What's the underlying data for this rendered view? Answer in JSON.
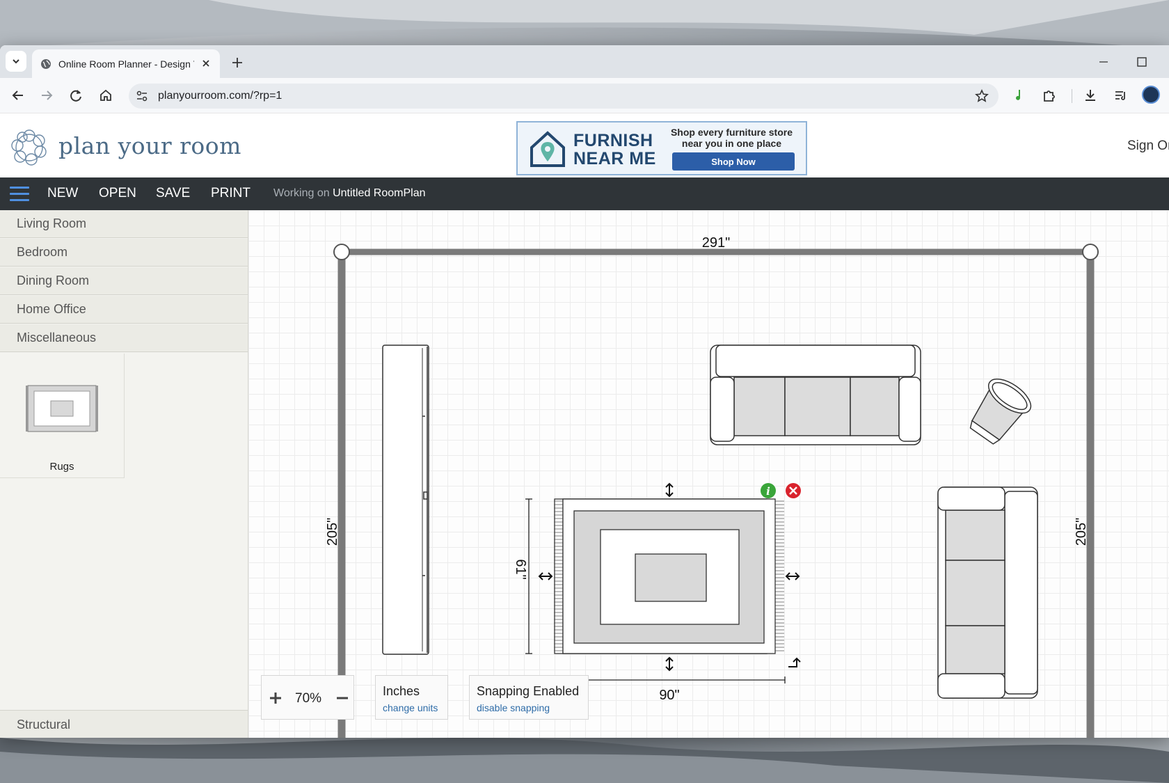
{
  "browser": {
    "tab_title": "Online Room Planner - Design Y",
    "url": "planyourroom.com/?rp=1"
  },
  "site": {
    "logo_text": "plan your room",
    "sign_on": "Sign On",
    "ad": {
      "brand_line1": "FURNISH",
      "brand_line2": "NEAR ME",
      "tagline": "Shop every furniture store near you in one place",
      "cta": "Shop Now"
    }
  },
  "menubar": {
    "new": "NEW",
    "open": "OPEN",
    "save": "SAVE",
    "print": "PRINT",
    "working_prefix": "Working on",
    "plan_name": "Untitled RoomPlan"
  },
  "sidebar": {
    "categories": [
      "Living Room",
      "Bedroom",
      "Dining Room",
      "Home Office",
      "Miscellaneous"
    ],
    "tile_label": "Rugs",
    "structural": "Structural"
  },
  "plan": {
    "room_width": "291\"",
    "room_height_left": "205\"",
    "room_height_right": "205\"",
    "rug_height": "61\"",
    "rug_width": "90\""
  },
  "controls": {
    "zoom": "70%",
    "units": "Inches",
    "change_units": "change units",
    "snapping": "Snapping Enabled",
    "disable_snapping": "disable snapping"
  },
  "colors": {
    "menubar": "#2f3438",
    "accent_blue": "#4f8fe0",
    "wall": "#7a7a7a",
    "info_green": "#3aa53a",
    "delete_red": "#d9232d"
  }
}
